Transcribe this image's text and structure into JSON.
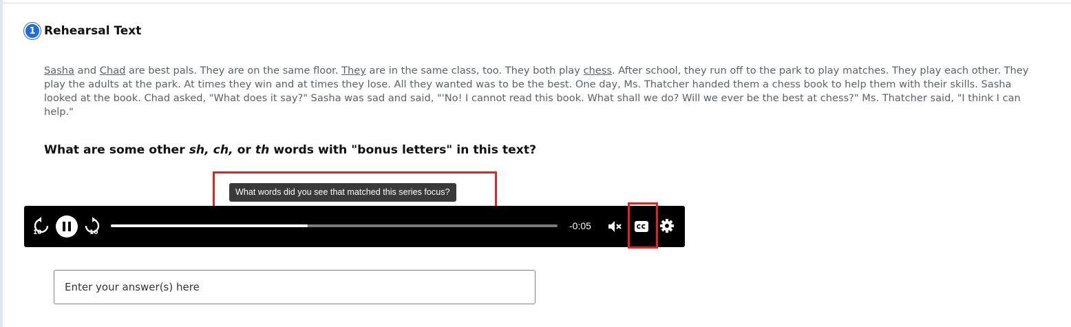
{
  "section": {
    "step_number": "1",
    "title": "Rehearsal Text"
  },
  "passage": {
    "w_sasha": "Sasha",
    "t1": " and ",
    "w_chad": "Chad",
    "t2": " are best pals. They are on the same floor. ",
    "w_they": "They",
    "t3": " are in the same class, too. They both play ",
    "w_chess": "chess",
    "t4": ". After school, they run off to the park to play matches. They play each other. They play the adults at the park. At times they win and at times they lose. All they wanted was to be the best. One day, Ms. Thatcher handed them a chess book to help them with their skills. Sasha looked at the book. Chad asked, \"What does it say?\" Sasha was sad and said, \"'No! I cannot read this book. What shall we do? Will we ever be the best at chess?\" Ms. Thatcher said, \"I think I can help.\""
  },
  "question": {
    "q1": "What are some other ",
    "q2": "sh, ch,",
    "q3": " or ",
    "q4": "th",
    "q5": " words with \"bonus letters\" in this text?"
  },
  "tooltip": {
    "text": "What words did you see that matched this series focus?"
  },
  "player": {
    "rewind_label": "10",
    "forward_label": "10",
    "progress_fraction": 0.44,
    "time_remaining": "-0:05",
    "icons": [
      "rewind-10-icon",
      "pause-icon",
      "forward-10-icon",
      "mute-icon",
      "closed-captions-icon",
      "settings-gear-icon"
    ]
  },
  "answer": {
    "placeholder": "Enter your answer(s) here"
  },
  "colors": {
    "badge": "#1d6bdc",
    "highlight": "#e52222",
    "player_bg": "#000000"
  }
}
